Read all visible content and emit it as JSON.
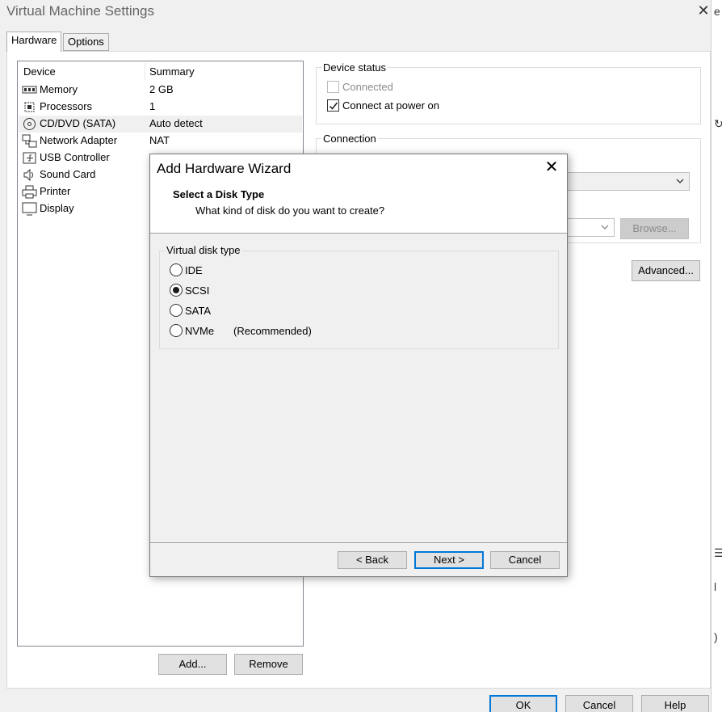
{
  "window": {
    "title": "Virtual Machine Settings",
    "close": "✕",
    "tabs": [
      "Hardware",
      "Options"
    ],
    "right_strip_glyphs": [
      "e",
      "↻",
      "☰",
      "l",
      ")"
    ]
  },
  "device_list": {
    "headers": {
      "device": "Device",
      "summary": "Summary"
    },
    "items": [
      {
        "name": "Memory",
        "summary": "2 GB",
        "icon": "memory-icon"
      },
      {
        "name": "Processors",
        "summary": "1",
        "icon": "processor-icon"
      },
      {
        "name": "CD/DVD (SATA)",
        "summary": "Auto detect",
        "icon": "cd-dvd-icon",
        "selected": true
      },
      {
        "name": "Network Adapter",
        "summary": "NAT",
        "icon": "network-adapter-icon"
      },
      {
        "name": "USB Controller",
        "summary": "",
        "icon": "usb-icon"
      },
      {
        "name": "Sound Card",
        "summary": "",
        "icon": "speaker-icon"
      },
      {
        "name": "Printer",
        "summary": "",
        "icon": "printer-icon"
      },
      {
        "name": "Display",
        "summary": "",
        "icon": "display-icon"
      }
    ],
    "add_label": "Add...",
    "remove_label": "Remove"
  },
  "device_status": {
    "label": "Device status",
    "connected": {
      "label": "Connected",
      "checked": false,
      "disabled": true
    },
    "connect_power": {
      "label": "Connect at power on",
      "checked": true
    }
  },
  "connection": {
    "label": "Connection",
    "browse_label": "Browse...",
    "advanced_label": "Advanced..."
  },
  "footer": {
    "ok": "OK",
    "cancel": "Cancel",
    "help": "Help"
  },
  "wizard": {
    "title": "Add Hardware Wizard",
    "close": "✕",
    "step_title": "Select a Disk Type",
    "step_subtitle": "What kind of disk do you want to create?",
    "group_label": "Virtual disk type",
    "options": [
      {
        "label": "IDE",
        "selected": false,
        "note": ""
      },
      {
        "label": "SCSI",
        "selected": true,
        "note": ""
      },
      {
        "label": "SATA",
        "selected": false,
        "note": ""
      },
      {
        "label": "NVMe",
        "selected": false,
        "note": "(Recommended)"
      }
    ],
    "back_label": "< Back",
    "next_label": "Next >",
    "cancel_label": "Cancel"
  }
}
